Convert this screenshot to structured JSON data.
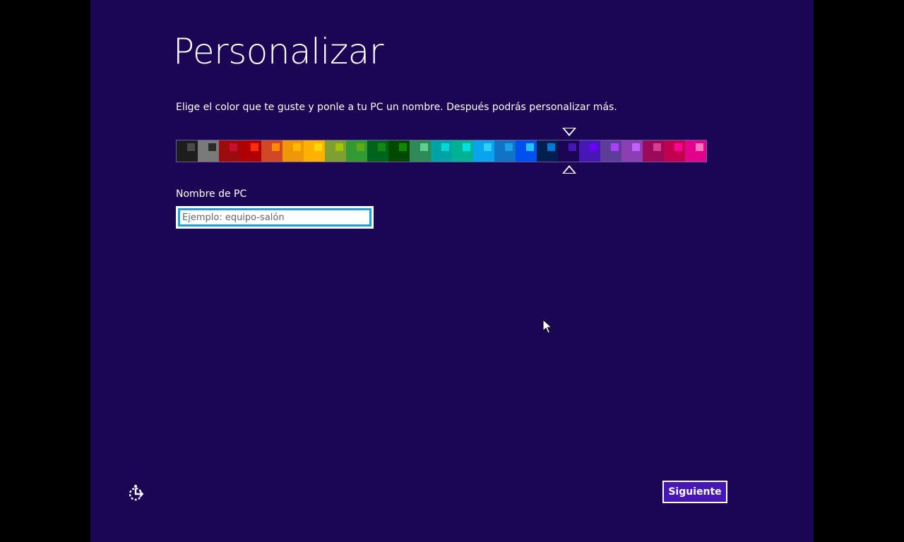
{
  "page": {
    "title": "Personalizar",
    "subtitle": "Elige el color que te guste y ponle a tu PC un nombre. Después podrás personalizar más.",
    "background_color": "#1b0555"
  },
  "color_picker": {
    "selected_index": 18,
    "swatches": [
      {
        "base": "#1d1d1d",
        "chip": "#4a4a4a"
      },
      {
        "base": "#7a7a7a",
        "chip": "#2a2a2a"
      },
      {
        "base": "#9e0b0f",
        "chip": "#c8102e"
      },
      {
        "base": "#b20000",
        "chip": "#ff2d00"
      },
      {
        "base": "#d24726",
        "chip": "#ff8c00"
      },
      {
        "base": "#f09609",
        "chip": "#ffb900"
      },
      {
        "base": "#ffb100",
        "chip": "#ffd700"
      },
      {
        "base": "#7fa030",
        "chip": "#a4c400"
      },
      {
        "base": "#339933",
        "chip": "#60a917"
      },
      {
        "base": "#00631b",
        "chip": "#128a12"
      },
      {
        "base": "#004a00",
        "chip": "#0f8a00"
      },
      {
        "base": "#2e8b57",
        "chip": "#5fcf8e"
      },
      {
        "base": "#00a3a3",
        "chip": "#00d8d8"
      },
      {
        "base": "#00b294",
        "chip": "#00e0e0"
      },
      {
        "base": "#0aa3f0",
        "chip": "#33ccff"
      },
      {
        "base": "#1073c6",
        "chip": "#1ba1e2"
      },
      {
        "base": "#0050ef",
        "chip": "#26c2ff"
      },
      {
        "base": "#001e4e",
        "chip": "#0078d7"
      },
      {
        "base": "#1b0555",
        "chip": "#4617b4"
      },
      {
        "base": "#4617b4",
        "chip": "#6a00ff"
      },
      {
        "base": "#5e3c99",
        "chip": "#aa40ff"
      },
      {
        "base": "#8c3fb2",
        "chip": "#c060ff"
      },
      {
        "base": "#9b0a5a",
        "chip": "#d63c8f"
      },
      {
        "base": "#c1004f",
        "chip": "#ff0097"
      },
      {
        "base": "#e3008c",
        "chip": "#ff76bc"
      }
    ]
  },
  "pc_name": {
    "label": "Nombre de PC",
    "placeholder": "Ejemplo: equipo-salón",
    "value": ""
  },
  "footer": {
    "next_label": "Siguiente",
    "ease_of_access_icon": "ease-of-access-icon"
  },
  "colors": {
    "button_fill": "#4617b4",
    "input_focus_border": "#1ba1e2"
  }
}
